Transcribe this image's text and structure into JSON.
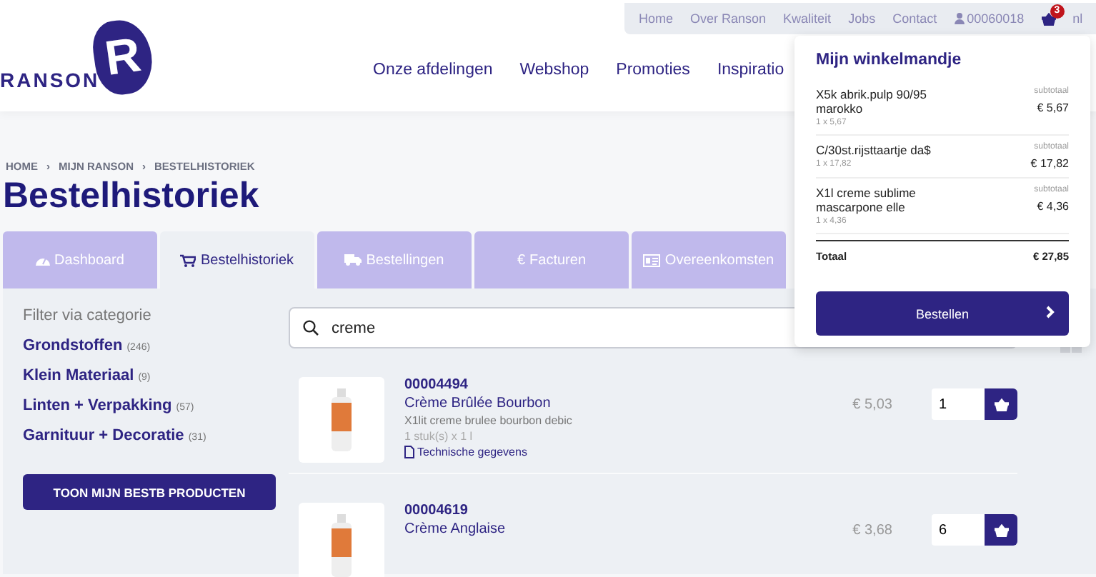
{
  "top_bar": {
    "links": [
      "Home",
      "Over Ranson",
      "Kwaliteit",
      "Jobs",
      "Contact"
    ],
    "account": "00060018",
    "cart_count": "3",
    "language": "nl"
  },
  "logo": {
    "text": "RANSON",
    "mark": "R"
  },
  "nav": [
    "Onze afdelingen",
    "Webshop",
    "Promoties",
    "Inspiratio"
  ],
  "breadcrumb": [
    "HOME",
    "MIJN RANSON",
    "BESTELHISTORIEK"
  ],
  "breadcrumb_separator": "›",
  "page_title": "Bestelhistoriek",
  "tabs": [
    {
      "label": "Dashboard",
      "kind": "gauge",
      "selected": false
    },
    {
      "label": "Bestelhistoriek",
      "kind": "cart",
      "selected": true
    },
    {
      "label": "Bestellingen",
      "kind": "truck",
      "selected": false
    },
    {
      "label": "Facturen",
      "kind": "euro",
      "symbol": "€",
      "selected": false
    },
    {
      "label": "Overeenkomsten",
      "kind": "card",
      "selected": false
    }
  ],
  "sidebar": {
    "heading": "Filter via categorie",
    "categories": [
      {
        "name": "Grondstoffen",
        "count": "(246)"
      },
      {
        "name": "Klein Materiaal",
        "count": "(9)"
      },
      {
        "name": "Linten + Verpakking",
        "count": "(57)"
      },
      {
        "name": "Garnituur + Decoratie",
        "count": "(31)"
      }
    ],
    "button": "TOON MIJN BESTB PRODUCTEN"
  },
  "search": {
    "value": "creme"
  },
  "products": [
    {
      "code": "00004494",
      "name": "Crème Brûlée Bourbon",
      "description": "X1lit creme brulee bourbon debic",
      "unit": "1 stuk(s) x 1 l",
      "link": "Technische gegevens",
      "price": "€ 5,03",
      "quantity": "1"
    },
    {
      "code": "00004619",
      "name": "Crème Anglaise",
      "price": "€ 3,68",
      "quantity": "6"
    }
  ],
  "cart_popup": {
    "title": "Mijn winkelmandje",
    "items": [
      {
        "name": "X5k abrik.pulp 90/95 marokko",
        "quantity": "1 x 5,67",
        "subtotal_label": "subtotaal",
        "subtotal": "€ 5,67"
      },
      {
        "name": "C/30st.rijsttaartje da$",
        "quantity": "1 x 17,82",
        "subtotal_label": "subtotaal",
        "subtotal": "€ 17,82"
      },
      {
        "name": "X1l creme sublime mascarpone elle",
        "quantity": "1 x 4,36",
        "subtotal_label": "subtotaal",
        "subtotal": "€ 4,36"
      }
    ],
    "total_label": "Totaal",
    "total": "€ 27,85",
    "button": "Bestellen"
  }
}
